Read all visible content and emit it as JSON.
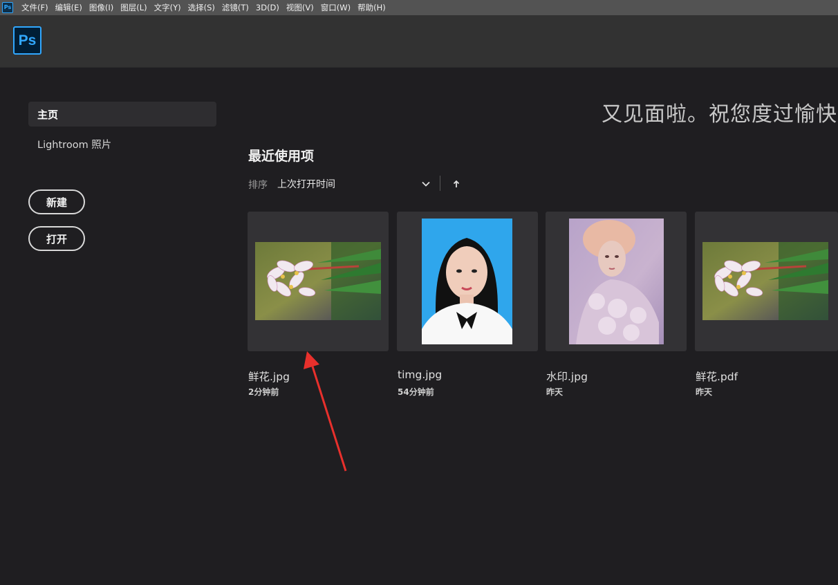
{
  "menubar": {
    "app_icon": "Ps",
    "items": [
      "文件(F)",
      "编辑(E)",
      "图像(I)",
      "图层(L)",
      "文字(Y)",
      "选择(S)",
      "滤镜(T)",
      "3D(D)",
      "视图(V)",
      "窗口(W)",
      "帮助(H)"
    ]
  },
  "header": {
    "logo_text": "Ps"
  },
  "sidebar": {
    "items": [
      {
        "label": "主页",
        "selected": true
      },
      {
        "label": "Lightroom 照片",
        "selected": false
      }
    ],
    "new_button": "新建",
    "open_button": "打开"
  },
  "main": {
    "welcome_text": "又见面啦。祝您度过愉快",
    "recent_title": "最近使用项",
    "sort_label": "排序",
    "sort_value": "上次打开时间",
    "sort_icon": "chevron-down-icon",
    "sort_direction_icon": "arrow-up-icon",
    "files": [
      {
        "name": "鲜花.jpg",
        "time": "2分钟前",
        "thumbnail": "flower"
      },
      {
        "name": "timg.jpg",
        "time": "54分钟前",
        "thumbnail": "portrait"
      },
      {
        "name": "水印.jpg",
        "time": "昨天",
        "thumbnail": "painting"
      },
      {
        "name": "鲜花.pdf",
        "time": "昨天",
        "thumbnail": "flower"
      }
    ]
  },
  "annotation": {
    "color": "#e8302c",
    "icon": "red-arrow-annotation"
  },
  "colors": {
    "accent": "#31a8ff",
    "background": "#1f1e21",
    "card": "#333235"
  }
}
